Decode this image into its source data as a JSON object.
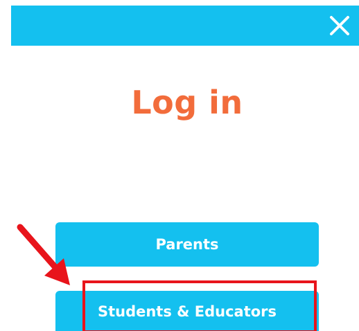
{
  "header": {
    "background_color": "#14c0ef",
    "close_icon": "close-icon"
  },
  "title": "Log in",
  "title_color": "#f26c3b",
  "buttons": [
    {
      "label": "Parents"
    },
    {
      "label": "Students & Educators"
    }
  ],
  "annotation": {
    "arrow_color": "#e8141b",
    "highlight_target": "Students & Educators"
  }
}
